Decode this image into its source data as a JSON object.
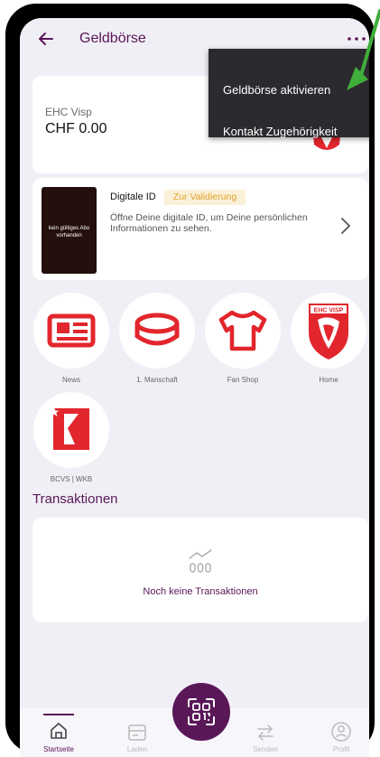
{
  "header": {
    "title": "Geldbörse"
  },
  "menu": {
    "items": [
      "Geldbörse aktivieren",
      "Kontakt Zugehörigkeit"
    ]
  },
  "wallet": {
    "club_name": "EHC Visp",
    "balance": "CHF 0.00"
  },
  "digital_id": {
    "thumb_text": "kein gültiges Abo vorhanden",
    "title": "Digitale ID",
    "badge": "Zur Validierung",
    "description": "Öffne Deine digitale ID, um Deine persönlichen Informationen zu sehen."
  },
  "shortcuts": [
    {
      "label": "News",
      "icon": "newspaper-icon"
    },
    {
      "label": "1. Manschaft",
      "icon": "hockey-puck-icon"
    },
    {
      "label": "Fan Shop",
      "icon": "tshirt-icon"
    },
    {
      "label": "Home",
      "icon": "ehc-visp-logo",
      "logo_text": "EHC VISP"
    },
    {
      "label": "BCVS | WKB",
      "icon": "bcvs-logo"
    }
  ],
  "transactions": {
    "title": "Transaktionen",
    "empty_text": "Noch keine Transaktionen"
  },
  "bottom_nav": [
    {
      "label": "Startseite",
      "icon": "home-icon",
      "active": true
    },
    {
      "label": "Laden",
      "icon": "wallet-icon",
      "active": false
    },
    {
      "label": "",
      "icon": "qr-code-icon",
      "active": false
    },
    {
      "label": "Senden",
      "icon": "transfer-icon",
      "active": false
    },
    {
      "label": "Profil",
      "icon": "profile-icon",
      "active": false
    }
  ],
  "colors": {
    "brand": "#5a1758",
    "background": "#f1eff6",
    "logo_red": "#e2262d",
    "badge_text": "#e0a32a",
    "arrow_green": "#3fae3a"
  }
}
